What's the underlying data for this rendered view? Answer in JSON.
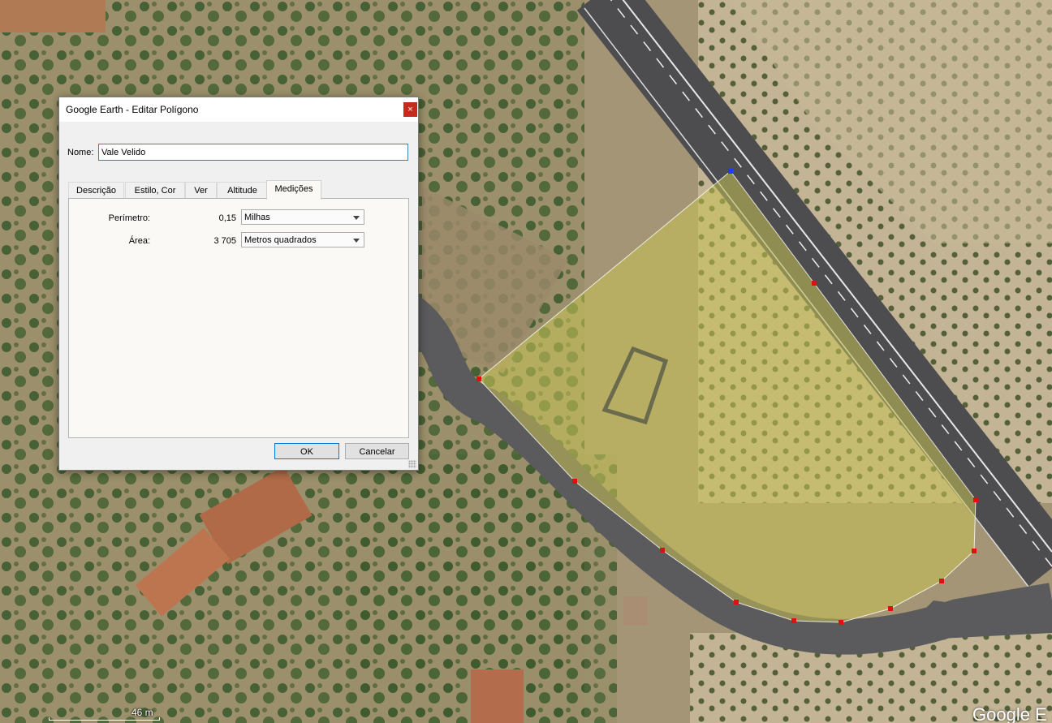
{
  "dialog": {
    "title": "Google Earth - Editar Polígono",
    "close_glyph": "×",
    "name_label": "Nome:",
    "name_value": "Vale Velido",
    "tabs": [
      {
        "label": "Descrição"
      },
      {
        "label": "Estilo, Cor"
      },
      {
        "label": "Ver"
      },
      {
        "label": "Altitude"
      },
      {
        "label": "Medições",
        "active": true
      }
    ],
    "measurements": {
      "perimeter_label": "Perímetro:",
      "perimeter_value": "0,15",
      "perimeter_unit": "Milhas",
      "area_label": "Área:",
      "area_value": "3 705",
      "area_unit": "Metros quadrados"
    },
    "ok_label": "OK",
    "cancel_label": "Cancelar"
  },
  "map": {
    "scale_label": "46 m",
    "watermark": "Google E",
    "polygon_fill": "#c8c256",
    "vertex_color": "#e01010",
    "selected_vertex_color": "#1e3cff"
  }
}
